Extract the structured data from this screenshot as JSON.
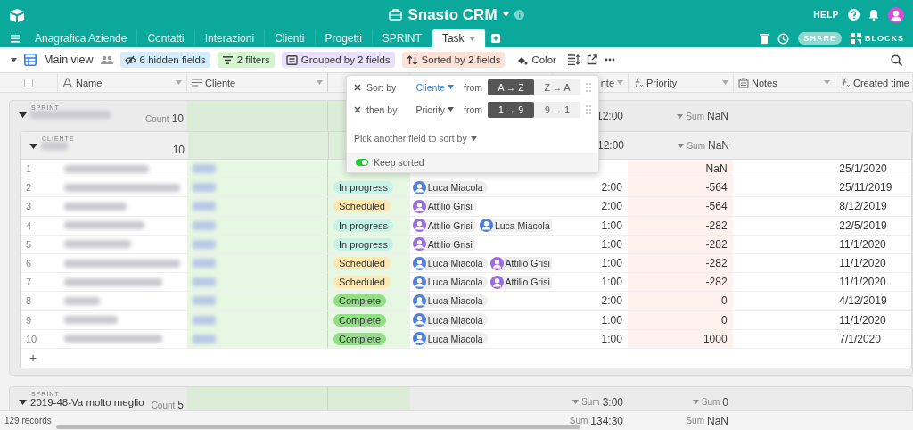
{
  "app": {
    "title": "Snasto CRM",
    "help": "HELP"
  },
  "tabs": [
    {
      "label": "Anagrafica Aziende",
      "selected": false
    },
    {
      "label": "Contatti",
      "selected": false
    },
    {
      "label": "Interazioni",
      "selected": false
    },
    {
      "label": "Clienti",
      "selected": false
    },
    {
      "label": "Progetti",
      "selected": false
    },
    {
      "label": "SPRINT",
      "selected": false
    },
    {
      "label": "Task",
      "selected": true
    }
  ],
  "tab_actions": {
    "share": "SHARE",
    "blocks": "BLOCKS"
  },
  "toolbar": {
    "view": "Main view",
    "buttons": [
      {
        "kind": "hide",
        "label": "6 hidden fields"
      },
      {
        "kind": "filter",
        "label": "2 filters"
      },
      {
        "kind": "group",
        "label": "Grouped by 2 fields"
      },
      {
        "kind": "sort",
        "label": "Sorted by 2 fields"
      },
      {
        "kind": "color",
        "label": "Color"
      }
    ]
  },
  "select_all": {
    "checked": false
  },
  "columns": [
    {
      "kind": "name",
      "label": "Name"
    },
    {
      "kind": "list",
      "label": "Cliente"
    },
    {
      "kind": "hidden"
    },
    {
      "kind": "hidden"
    },
    {
      "kind": "plain",
      "label": "nte"
    },
    {
      "kind": "formula",
      "label": "Priority"
    },
    {
      "kind": "notes",
      "label": "Notes"
    },
    {
      "kind": "formula",
      "label": "Created time"
    }
  ],
  "groups": [
    {
      "label": "SPRINT",
      "count_label": "Count",
      "count": "10",
      "duration_sum": {
        "value": "12:00"
      },
      "priority_sum": {
        "label": "Sum",
        "value": "NaN"
      },
      "subgroups": [
        {
          "label": "CLIENTE",
          "count": "10",
          "add_row": "+",
          "duration_sum": {
            "value": "12:00"
          },
          "priority_sum": {
            "label": "Sum",
            "value": "NaN"
          },
          "rows": [
            {
              "number": "1",
              "priority": "NaN",
              "created": "25/1/2020"
            },
            {
              "number": "2",
              "status": {
                "label": "In progress",
                "color": "#c6f2e8"
              },
              "people": [
                {
                  "name": "Luca Miacola",
                  "color": "#4f7fe0"
                }
              ],
              "duration": "2:00",
              "priority": "-564",
              "created": "25/11/2019"
            },
            {
              "number": "3",
              "status": {
                "label": "Scheduled",
                "color": "#ffe7b0"
              },
              "people": [
                {
                  "name": "Attilio Grisi",
                  "color": "#9b6be0"
                }
              ],
              "duration": "2:00",
              "priority": "-564",
              "created": "8/12/2019"
            },
            {
              "number": "4",
              "status": {
                "label": "In progress",
                "color": "#c6f2e8"
              },
              "people": [
                {
                  "name": "Attilio Grisi",
                  "color": "#9b6be0"
                },
                {
                  "name": "Luca Miacola",
                  "color": "#4f7fe0"
                }
              ],
              "duration": "1:00",
              "priority": "-282",
              "created": "22/5/2019"
            },
            {
              "number": "5",
              "status": {
                "label": "In progress",
                "color": "#c6f2e8"
              },
              "people": [
                {
                  "name": "Attilio Grisi",
                  "color": "#9b6be0"
                }
              ],
              "duration": "1:00",
              "priority": "-282",
              "created": "11/1/2020"
            },
            {
              "number": "6",
              "status": {
                "label": "Scheduled",
                "color": "#ffe7b0"
              },
              "people": [
                {
                  "name": "Luca Miacola",
                  "color": "#4f7fe0"
                },
                {
                  "name": "Attilio Grisi",
                  "color": "#9b6be0"
                }
              ],
              "duration": "1:00",
              "priority": "-282",
              "created": "11/1/2020"
            },
            {
              "number": "7",
              "status": {
                "label": "Scheduled",
                "color": "#ffe7b0"
              },
              "people": [
                {
                  "name": "Luca Miacola",
                  "color": "#4f7fe0"
                },
                {
                  "name": "Attilio Grisi",
                  "color": "#9b6be0"
                }
              ],
              "duration": "1:00",
              "priority": "-282",
              "created": "11/1/2020"
            },
            {
              "number": "8",
              "status": {
                "label": "Complete",
                "color": "#93df87"
              },
              "people": [
                {
                  "name": "Luca Miacola",
                  "color": "#4f7fe0"
                }
              ],
              "duration": "2:00",
              "priority": "0",
              "created": "4/12/2019"
            },
            {
              "number": "9",
              "status": {
                "label": "Complete",
                "color": "#93df87"
              },
              "people": [
                {
                  "name": "Luca Miacola",
                  "color": "#4f7fe0"
                }
              ],
              "duration": "1:00",
              "priority": "0",
              "created": "11/1/2020"
            },
            {
              "number": "10",
              "status": {
                "label": "Complete",
                "color": "#93df87"
              },
              "people": [
                {
                  "name": "Luca Miacola",
                  "color": "#4f7fe0"
                }
              ],
              "duration": "1:00",
              "priority": "1000",
              "created": "7/1/2020"
            }
          ]
        }
      ]
    },
    {
      "label": "SPRINT",
      "name": "2019-48-Va molto meglio",
      "count_label": "Count",
      "count": "5",
      "duration_sum": {
        "label": "Sum",
        "value": "3:00"
      },
      "priority_sum": {
        "label": "Sum",
        "value": "0"
      }
    }
  ],
  "footer": {
    "records": "129 records",
    "duration_sum": {
      "label": "Sum",
      "value": "134:30"
    },
    "priority_sum": {
      "label": "Sum",
      "value": "NaN"
    }
  },
  "sort_popup": {
    "rules": [
      {
        "label": "Sort by",
        "field": "Cliente",
        "field_selected": true,
        "from": "from",
        "options": [
          {
            "label": "A → Z",
            "selected": true
          },
          {
            "label": "Z → A",
            "selected": false
          }
        ]
      },
      {
        "label": "then by",
        "field": "Priority",
        "field_selected": false,
        "from": "from",
        "options": [
          {
            "label": "1 → 9",
            "selected": true
          },
          {
            "label": "9 → 1",
            "selected": false
          }
        ]
      }
    ],
    "pick": "Pick another field to sort by",
    "keep_sorted": {
      "label": "Keep sorted",
      "on": true
    }
  }
}
